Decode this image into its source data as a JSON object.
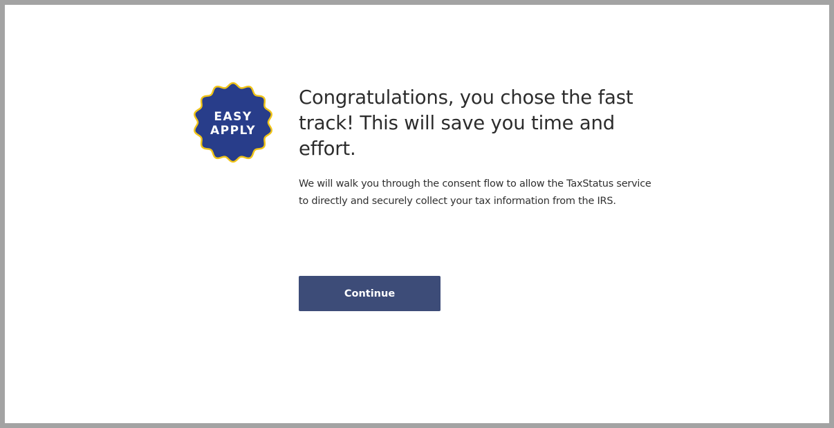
{
  "badge": {
    "line1": "EASY",
    "line2": "APPLY",
    "fill_color": "#283d8a",
    "border_color": "#f0c419",
    "text_color": "#ffffff"
  },
  "headline": "Congratulations, you chose the fast track! This will save you time and effort.",
  "description": "We will walk you through the consent flow to allow the TaxStatus service to directly and securely collect your tax information from the IRS.",
  "continue_button": {
    "label": "Continue",
    "color": "#3d4c78"
  }
}
